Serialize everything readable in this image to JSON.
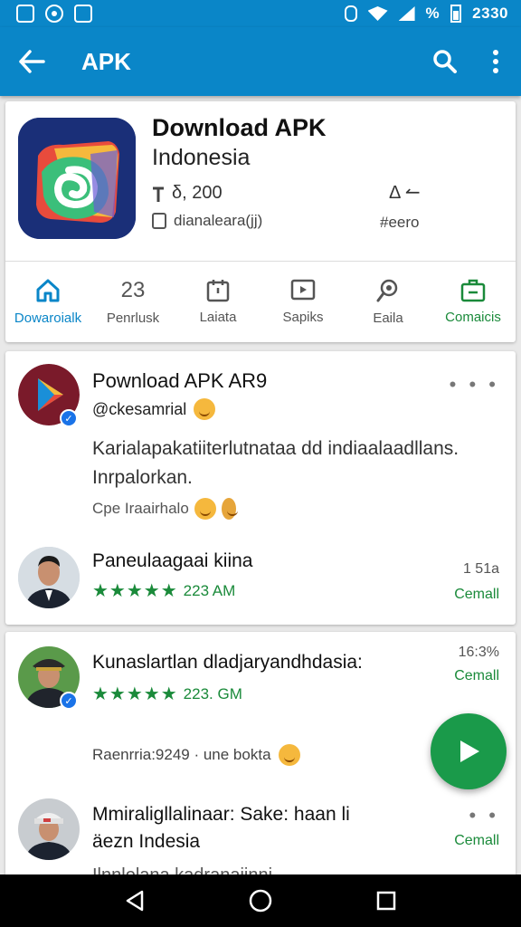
{
  "status": {
    "battery_text": "%",
    "time": "2330"
  },
  "app_bar": {
    "title": "APK"
  },
  "app": {
    "name": "Download APK",
    "subtitle": "Indonesia",
    "meta_size": "δ, 200",
    "meta_dev": "dianaleara(jj)",
    "meta_right_top": "Δ ↼",
    "meta_right_bottom": "#eero"
  },
  "tabs": [
    {
      "label": "Dowaroialk",
      "num": "",
      "icon": "home-icon"
    },
    {
      "label": "Penrlusk",
      "num": "23",
      "icon": ""
    },
    {
      "label": "Laiata",
      "num": "",
      "icon": "calendar-icon"
    },
    {
      "label": "Sapiks",
      "num": "",
      "icon": "video-icon"
    },
    {
      "label": "Eaila",
      "num": "",
      "icon": "search-pin-icon"
    },
    {
      "label": "Comaicis",
      "num": "",
      "icon": "briefcase-icon"
    }
  ],
  "post": {
    "title": "Pownload APK AR9",
    "handle": "@ckesamrial",
    "more": "• • •",
    "body": "Karialapakatiiterlutnataa dd indiaalaadllans. Inrpalorkan.",
    "footer": "Cpe Iraairhalo"
  },
  "comments": [
    {
      "name": "Paneulaagaai kiina",
      "stars": "★★★★★",
      "time_label": "223 AM",
      "right_top": "1 51a",
      "right_link": "Cemall"
    },
    {
      "name": "Kunaslartlan dladjaryandhdasia:",
      "stars": "★★★★★",
      "time_label": "223. GM",
      "right_top": "16:3%",
      "right_link": "Cemall"
    },
    {
      "name": "Mmiraligllalinaar: Sake: haan li",
      "name2": "äezn Indesia",
      "right_link": "Cemall",
      "more": "• •"
    }
  ],
  "replies": {
    "text": "Raenrria:9249 · une bokta"
  },
  "cut_text": "Ilnnlolana kadranaiinni",
  "colors": {
    "primary": "#0a86c8",
    "accent_green": "#1a9a4a",
    "text_green": "#1a8a3a"
  }
}
